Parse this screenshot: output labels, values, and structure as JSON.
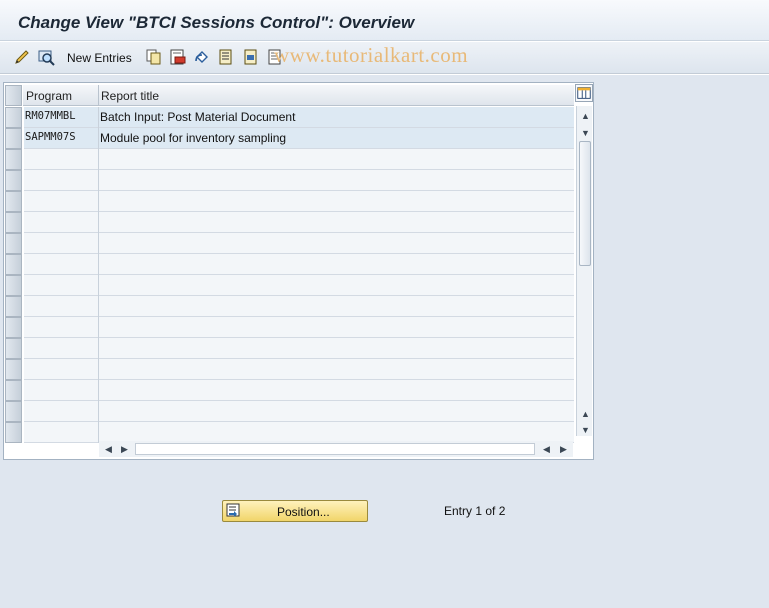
{
  "header": {
    "title": "Change View \"BTCI Sessions Control\": Overview"
  },
  "toolbar": {
    "new_entries_label": "New Entries",
    "watermark": "www.tutorialkart.com",
    "icons": [
      "change-display-icon",
      "find-icon",
      "copy-as-icon",
      "delete-icon",
      "undo-change-icon",
      "select-all-icon",
      "select-block-icon",
      "deselect-all-icon"
    ]
  },
  "table": {
    "columns": {
      "program": "Program",
      "report_title": "Report title"
    },
    "rows": [
      {
        "program": "RM07MMBL",
        "report_title": "Batch Input: Post Material Document"
      },
      {
        "program": "SAPMM07S",
        "report_title": "Module pool for inventory sampling"
      }
    ]
  },
  "footer": {
    "position_button_label": "Position...",
    "entry_info": "Entry 1 of 2"
  },
  "colors": {
    "position_button": "#f1d56a",
    "row_filled": "#dde9f3",
    "title_text": "#1c2836"
  }
}
